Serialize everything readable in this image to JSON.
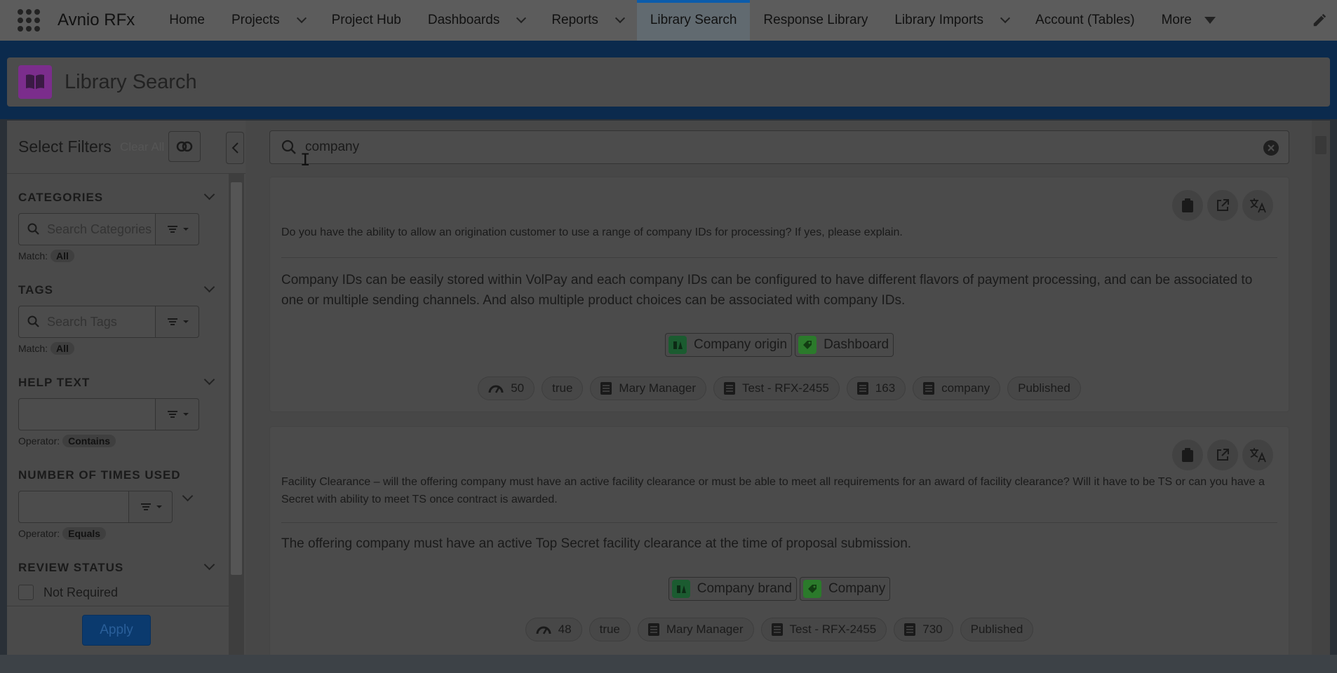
{
  "app": {
    "name": "Avnio RFx"
  },
  "nav": {
    "items": [
      {
        "label": "Home",
        "has_menu": false,
        "active": false
      },
      {
        "label": "Projects",
        "has_menu": true,
        "active": false
      },
      {
        "label": "Project Hub",
        "has_menu": false,
        "active": false
      },
      {
        "label": "Dashboards",
        "has_menu": true,
        "active": false
      },
      {
        "label": "Reports",
        "has_menu": true,
        "active": false
      },
      {
        "label": "Library Search",
        "has_menu": false,
        "active": true
      },
      {
        "label": "Response Library",
        "has_menu": false,
        "active": false
      },
      {
        "label": "Library Imports",
        "has_menu": true,
        "active": false
      },
      {
        "label": "Account (Tables)",
        "has_menu": false,
        "active": false
      }
    ],
    "more_label": "More"
  },
  "page": {
    "title": "Library Search"
  },
  "filters": {
    "title": "Select Filters",
    "clear_all": "Clear All",
    "categories": {
      "label": "CATEGORIES",
      "placeholder": "Search Categories",
      "match_label": "Match:",
      "match_value": "All"
    },
    "tags": {
      "label": "TAGS",
      "placeholder": "Search Tags",
      "match_label": "Match:",
      "match_value": "All"
    },
    "help_text": {
      "label": "HELP TEXT",
      "value": "",
      "operator_label": "Operator:",
      "operator_value": "Contains"
    },
    "times_used": {
      "label": "NUMBER OF TIMES USED",
      "value": "",
      "operator_label": "Operator:",
      "operator_value": "Equals"
    },
    "review_status": {
      "label": "REVIEW STATUS",
      "options": [
        {
          "label": "Not Required",
          "checked": false
        }
      ]
    },
    "apply_label": "Apply"
  },
  "search": {
    "query": "company"
  },
  "results": [
    {
      "question": "Do you have the ability to allow an origination customer to use a range of company IDs for processing? If yes, please explain.",
      "answer": "Company IDs can be easily stored within VolPay and each company IDs can be configured to have different flavors of payment processing, and can be associated to one or multiple sending channels. And also multiple product choices can be associated with company IDs.",
      "category": "Company origin",
      "tag": "Dashboard",
      "meta": {
        "score": "50",
        "flag": "true",
        "owner": "Mary Manager",
        "project": "Test - RFX-2455",
        "number": "163",
        "keyword": "company",
        "status": "Published"
      }
    },
    {
      "question": "Facility Clearance – will the offering company must have an active facility clearance or must be able to meet all requirements for an award of facility clearance?  Will it have to be TS or can you have a Secret with ability to meet TS once contract is awarded.",
      "answer": "The offering company must have an active Top Secret facility clearance at the time of proposal submission.",
      "category": "Company brand",
      "tag": "Company",
      "meta": {
        "score": "48",
        "flag": "true",
        "owner": "Mary Manager",
        "project": "Test - RFX-2455",
        "number": "730",
        "status": "Published"
      }
    }
  ],
  "colors": {
    "accent": "#0b5cab",
    "page_icon": "#7b2d8c",
    "category_icon": "#1b5b30",
    "tag_icon": "#2b7a2b"
  }
}
